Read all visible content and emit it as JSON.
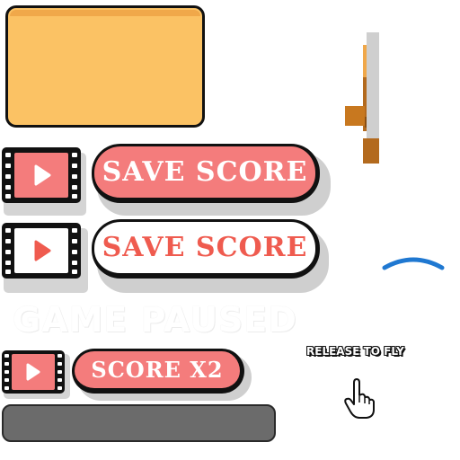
{
  "buttons": {
    "save_score_primary": "SAVE SCORE",
    "save_score_secondary": "SAVE SCORE",
    "score_x2": "SCORE X2"
  },
  "overlay": {
    "paused_title": "GAME PAUSED",
    "release_hint": "RELEASE TO FLY"
  },
  "icons": {
    "video": "video-film-play-icon",
    "hand": "hand-pointer-icon",
    "ring": "blue-arc",
    "ramp": "wooden-ramp"
  },
  "colors": {
    "panel": "#fbc264",
    "button_fill": "#f47c7c",
    "button_text_outline": "#ef5b4f",
    "bar": "#6b6b6b",
    "arc": "#1f78d1"
  }
}
